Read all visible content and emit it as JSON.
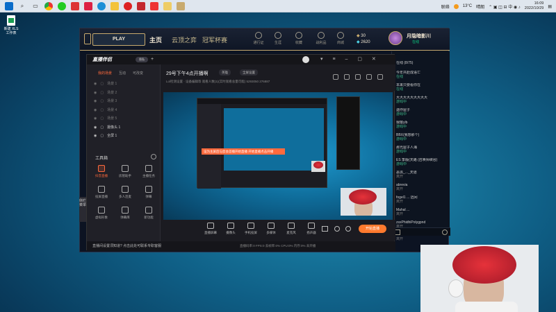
{
  "taskbar": {
    "icons": [
      "search-icon",
      "taskview-icon",
      "chrome-icon",
      "wechat-icon",
      "netease-icon",
      "app-icon",
      "app-icon",
      "edge-icon",
      "explorer-icon",
      "netease-music-icon",
      "app-icon",
      "app-icon",
      "app-icon",
      "lol-icon"
    ],
    "tray": {
      "network": "联络",
      "weather_temp": "13°C",
      "weather": "晴朗",
      "time": "16:09",
      "date": "2022/10/29"
    }
  },
  "desktop": {
    "icon_label": "新建 XLS 工作表"
  },
  "game_client": {
    "play_label": "PLAY",
    "nav": [
      "主页",
      "云顶之弈",
      "冠军杯赛"
    ],
    "icons": [
      {
        "name": "rune-icon",
        "label": "通行证"
      },
      {
        "name": "profile-icon",
        "label": "生涯"
      },
      {
        "name": "collection-icon",
        "label": "收藏"
      },
      {
        "name": "crafting-icon",
        "label": "战利品"
      },
      {
        "name": "store-icon",
        "label": "商城"
      }
    ],
    "currency": {
      "rp": "30",
      "be": "2620"
    },
    "player": {
      "name": "月隐暗影川",
      "status": "在线"
    },
    "chat": {
      "header": "在线 (8/75)",
      "entries": [
        {
          "name": "今年共赴成语亡",
          "status": "在线"
        },
        {
          "name": "本来只要看你在",
          "status": "在线"
        },
        {
          "name": "大大大大大大大大大",
          "status": "游戏中"
        },
        {
          "name": "遇作屋子",
          "status": "游戏中"
        },
        {
          "name": "我敬ylb",
          "status": "游戏中"
        },
        {
          "name": "BBX(我想那个)",
          "status": "游戏中"
        },
        {
          "name": "那光屋子人海",
          "status": "游戏中"
        },
        {
          "name": "ES 季版(天路 (召唤师峡谷)",
          "status": "游戏中"
        },
        {
          "name": "恶派_..._天道",
          "status": "离开"
        },
        {
          "name": "abrevia",
          "status": "离开"
        },
        {
          "name": "fogel1 ... 远间",
          "status": "离开"
        },
        {
          "name": "Mahal ...",
          "status": "离开"
        },
        {
          "name": "zsxPhidhiPolygpnd",
          "status": "离开"
        },
        {
          "name": "~~~~~~~~~~",
          "status": "离开"
        }
      ]
    }
  },
  "stream_app": {
    "logo": "直播伴侣",
    "pill": "隐私",
    "tabs": [
      "我的场景",
      "互动",
      "可改变"
    ],
    "scenes": [
      "场景 1",
      "场景 2",
      "场景 3",
      "场景 4",
      "场景 5",
      "摄像头 1",
      "全屏 1"
    ],
    "toolbox_title": "工具箱",
    "tools": [
      "抖音直播",
      "房管助手",
      "主播任务",
      "投屏直播",
      "多人连麦",
      "弹幕",
      "虚拟形象",
      "弹幕库",
      "新功能"
    ],
    "title": "29号下午4点开播啊",
    "tags": [
      "英雄",
      "全屏设置"
    ],
    "info": "Lol检测设置 · 设备编辑等  观看人数(1)(实时观看总量可能) 5293050   276887",
    "bottom_buttons": [
      "直播屏幕",
      "摄像头",
      "手机投屏",
      "多媒体",
      "麦克风",
      "扬声器"
    ],
    "live_label": "开始直播",
    "toast": "设为主屏后与您会首播开始直播  开始直播点击开播",
    "foot": "直播间设置须知道? 点击此处可联系专职客服",
    "stats": "直播码率:0  FPS:0  丢帧率:0%  CPU:0%  内存:0%  未开播"
  },
  "side_tab": "侧栏菜单"
}
